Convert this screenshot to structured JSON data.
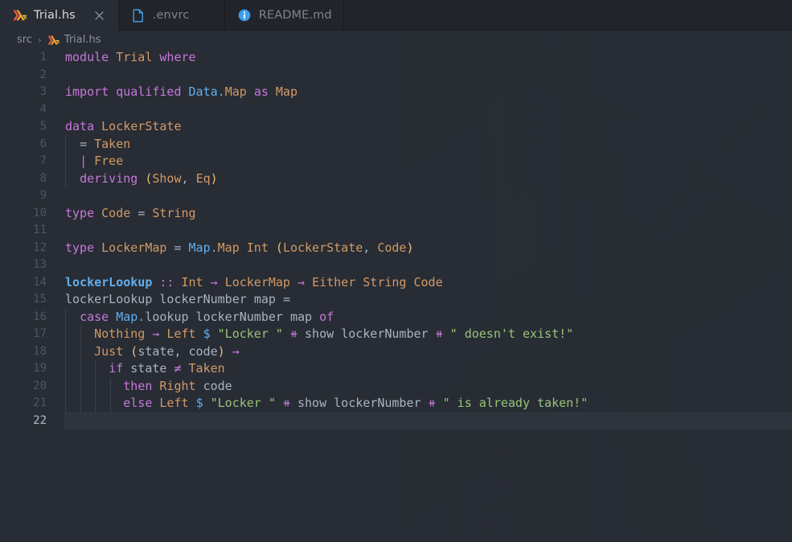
{
  "window": {
    "title": "Trial.hs",
    "bg_color": "#282c34",
    "tabbar_color": "#21252b"
  },
  "tabs": [
    {
      "label": "Trial.hs",
      "icon": "haskell-icon",
      "active": true,
      "closable": true,
      "close_icon": "close-icon"
    },
    {
      "label": ".envrc",
      "icon": "file-icon",
      "active": false,
      "closable": false
    },
    {
      "label": "README.md",
      "icon": "info-icon",
      "active": false,
      "closable": false
    }
  ],
  "breadcrumb": {
    "separator": "›",
    "items": [
      {
        "label": "src",
        "icon": null
      },
      {
        "label": "Trial.hs",
        "icon": "haskell-icon"
      }
    ]
  },
  "editor": {
    "language": "haskell",
    "active_line": 22,
    "first_line": 1,
    "last_line": 22,
    "lines": [
      {
        "n": 1,
        "indent": 0,
        "text": "module Trial where"
      },
      {
        "n": 2,
        "indent": 0,
        "text": ""
      },
      {
        "n": 3,
        "indent": 0,
        "text": "import qualified Data.Map as Map"
      },
      {
        "n": 4,
        "indent": 0,
        "text": ""
      },
      {
        "n": 5,
        "indent": 0,
        "text": "data LockerState"
      },
      {
        "n": 6,
        "indent": 1,
        "text": "  = Taken"
      },
      {
        "n": 7,
        "indent": 1,
        "text": "  | Free"
      },
      {
        "n": 8,
        "indent": 1,
        "text": "  deriving (Show, Eq)"
      },
      {
        "n": 9,
        "indent": 0,
        "text": ""
      },
      {
        "n": 10,
        "indent": 0,
        "text": "type Code = String"
      },
      {
        "n": 11,
        "indent": 0,
        "text": ""
      },
      {
        "n": 12,
        "indent": 0,
        "text": "type LockerMap = Map.Map Int (LockerState, Code)"
      },
      {
        "n": 13,
        "indent": 0,
        "text": ""
      },
      {
        "n": 14,
        "indent": 0,
        "text": "lockerLookup :: Int → LockerMap → Either String Code"
      },
      {
        "n": 15,
        "indent": 0,
        "text": "lockerLookup lockerNumber map ="
      },
      {
        "n": 16,
        "indent": 1,
        "text": "  case Map.lookup lockerNumber map of"
      },
      {
        "n": 17,
        "indent": 2,
        "text": "    Nothing → Left $ \"Locker \" ⧺ show lockerNumber ⧺ \" doesn't exist!\""
      },
      {
        "n": 18,
        "indent": 2,
        "text": "    Just (state, code) →"
      },
      {
        "n": 19,
        "indent": 3,
        "text": "      if state ≠ Taken"
      },
      {
        "n": 20,
        "indent": 4,
        "text": "        then Right code"
      },
      {
        "n": 21,
        "indent": 4,
        "text": "        else Left $ \"Locker \" ⧺ show lockerNumber ⧺ \" is already taken!\""
      },
      {
        "n": 22,
        "indent": 0,
        "text": ""
      }
    ]
  },
  "theme": {
    "keyword": "#c678dd",
    "type": "#d19a66",
    "function": "#61afef",
    "variable": "#abb2bf",
    "string": "#98c379",
    "operator": "#c678dd",
    "bracket1": "#e5c07b",
    "gutter": "#4e5564",
    "gutter_active": "#b6bcc8",
    "indent_guide": "#3c424e"
  }
}
